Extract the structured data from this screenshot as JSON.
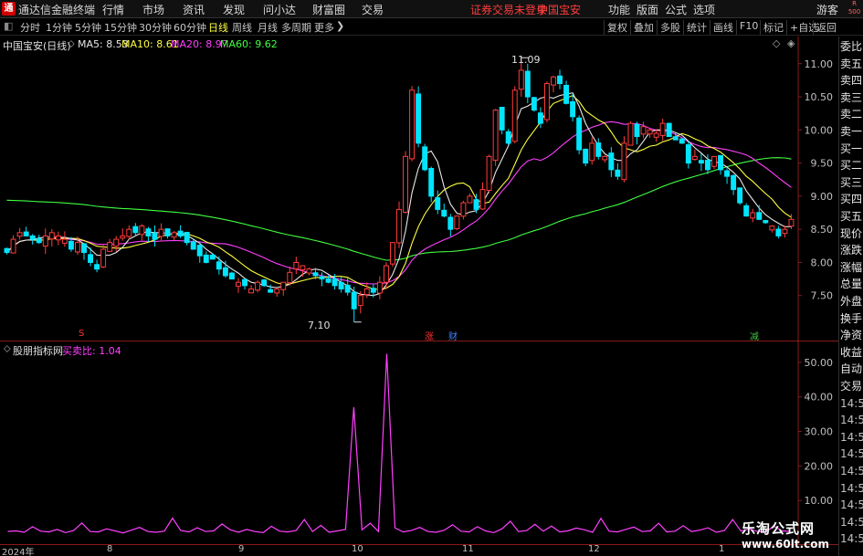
{
  "titlebar": {
    "logo_text": "通",
    "app_title": "通达信金融终端",
    "menus": [
      "行情",
      "市场",
      "资讯",
      "发现",
      "问小达",
      "财富圈",
      "交易"
    ],
    "login_notice": "证券交易未登录",
    "stock_title": "中国宝安",
    "right_menus": [
      "功能",
      "版面",
      "公式",
      "选项"
    ],
    "user": "游客",
    "badge_top": "R",
    "badge_bottom": "500"
  },
  "periods": {
    "items": [
      "分时",
      "1分钟",
      "5分钟",
      "15分钟",
      "30分钟",
      "60分钟",
      "日线",
      "周线",
      "月线",
      "多周期",
      "更多"
    ],
    "active": "日线",
    "more_arrow": "❯",
    "right_buttons": [
      "复权",
      "叠加",
      "多股",
      "统计",
      "画线",
      "F10",
      "标记",
      "+自选",
      "返回"
    ]
  },
  "main_chart": {
    "stock_label": "中国宝安(日线)",
    "ma": [
      {
        "label": "MA5: 8.53",
        "color": "#e8e8e8"
      },
      {
        "label": "MA10: 8.61",
        "color": "#ffff40"
      },
      {
        "label": "MA20: 8.97",
        "color": "#ff40ff"
      },
      {
        "label": "MA60: 9.62",
        "color": "#40ff40"
      }
    ],
    "high_label": "11.09",
    "low_label": "7.10",
    "markers": [
      {
        "text": "S",
        "color": "#ff3030"
      },
      {
        "text": "涨",
        "color": "#ff3030"
      },
      {
        "text": "财",
        "color": "#4080ff"
      },
      {
        "text": "减",
        "color": "#40c040"
      }
    ],
    "diamond_icon": "◇",
    "collapse_icon": "◈"
  },
  "indicator": {
    "name": "股朋指标网",
    "series_label": "买卖比: 1.04",
    "series_color": "#ff40ff"
  },
  "sidebar": {
    "items": [
      "委比",
      "卖五",
      "卖四",
      "卖三",
      "卖二",
      "卖一",
      "买一",
      "买二",
      "买三",
      "买四",
      "买五",
      "现价",
      "涨跌",
      "涨幅",
      "总量",
      "外盘",
      "换手",
      "净资",
      "收益",
      "自动",
      "交易",
      "14:56",
      "14:56",
      "14:56",
      "14:56",
      "14:56",
      "14:56",
      "14:56",
      "14:56",
      "14:56"
    ]
  },
  "timeline": {
    "labels": [
      "2024年",
      "8",
      "9",
      "10",
      "11",
      "12",
      "1"
    ]
  },
  "watermark": {
    "line1": "乐淘公式网",
    "line2": "www.60lt.com"
  },
  "colors": {
    "up": "#ff3c3c",
    "down": "#00e5ff",
    "ma5": "#e8e8e8",
    "ma10": "#ffff40",
    "ma20": "#ff40ff",
    "ma60": "#40ff40",
    "axis": "#8b1a1a"
  },
  "chart_data": [
    {
      "type": "candlestick",
      "title": "中国宝安(日线)",
      "ylim": [
        7.0,
        11.3
      ],
      "y_ticks": [
        7.5,
        8.0,
        8.5,
        9.0,
        9.5,
        10.0,
        10.5,
        11.0
      ],
      "x_labels": [
        "2024年",
        "8",
        "9",
        "10",
        "11",
        "12",
        "1"
      ],
      "high": 11.09,
      "low": 7.1,
      "closes": [
        8.15,
        8.35,
        8.45,
        8.4,
        8.35,
        8.3,
        8.4,
        8.45,
        8.4,
        8.35,
        8.2,
        8.3,
        8.15,
        8.0,
        7.9,
        8.2,
        8.3,
        8.35,
        8.4,
        8.5,
        8.45,
        8.55,
        8.4,
        8.35,
        8.5,
        8.4,
        8.45,
        8.4,
        8.3,
        8.2,
        8.1,
        8.0,
        8.05,
        7.9,
        7.8,
        7.75,
        7.7,
        7.65,
        7.6,
        7.7,
        7.65,
        7.55,
        7.6,
        7.7,
        7.85,
        8.0,
        7.95,
        7.9,
        7.8,
        7.75,
        7.7,
        7.65,
        7.6,
        7.55,
        7.3,
        7.5,
        7.6,
        7.55,
        7.7,
        7.95,
        8.3,
        8.8,
        9.6,
        10.6,
        9.8,
        9.4,
        9.0,
        8.8,
        8.7,
        8.5,
        8.7,
        8.9,
        9.0,
        8.8,
        9.1,
        9.6,
        10.3,
        10.0,
        9.8,
        10.6,
        10.9,
        10.5,
        10.3,
        10.1,
        10.7,
        10.8,
        10.7,
        10.4,
        10.2,
        9.7,
        9.5,
        9.8,
        9.6,
        9.6,
        9.4,
        9.3,
        9.8,
        10.1,
        9.9,
        10.05,
        10.0,
        9.95,
        10.1,
        9.9,
        9.85,
        9.8,
        9.5,
        9.6,
        9.5,
        9.4,
        9.6,
        9.4,
        9.3,
        9.1,
        8.9,
        8.7,
        8.75,
        8.65,
        8.6,
        8.55,
        8.4,
        8.5,
        8.65
      ]
    },
    {
      "type": "line",
      "title": "股朋指标网",
      "series": [
        {
          "name": "买卖比",
          "values": [
            1.04,
            1.2,
            0.8,
            2.4,
            1.1,
            0.9,
            1.6,
            0.7,
            1.3,
            3.5,
            1.0,
            0.9,
            1.8,
            1.2,
            0.6,
            1.4,
            2.2,
            1.0,
            0.8,
            1.1,
            4.9,
            1.3,
            0.9,
            2.1,
            1.0,
            1.2,
            3.2,
            1.5,
            0.8,
            1.6,
            1.0,
            0.7,
            2.5,
            1.1,
            0.9,
            1.3,
            4.5,
            1.0,
            2.8,
            0.8,
            1.2,
            1.6,
            37.0,
            1.5,
            3.4,
            1.0,
            52.5,
            2.1,
            0.9,
            1.3,
            2.2,
            1.0,
            0.8,
            1.4,
            3.0,
            1.1,
            0.9,
            2.4,
            1.2,
            0.7,
            1.8,
            4.0,
            1.0,
            1.3,
            3.1,
            1.1,
            2.6,
            0.9,
            1.2,
            2.0,
            1.5,
            0.8,
            4.8,
            1.1,
            0.9,
            1.6,
            2.3,
            1.0,
            1.2,
            3.4,
            0.9,
            1.1,
            2.7,
            1.0,
            1.4,
            2.1,
            0.8,
            1.3,
            4.5,
            1.1,
            1.8,
            1.0,
            0.9,
            2.5,
            1.2,
            1.04
          ]
        }
      ],
      "ylim": [
        0,
        55
      ],
      "y_ticks": [
        10.0,
        20.0,
        30.0,
        40.0,
        50.0
      ]
    }
  ]
}
